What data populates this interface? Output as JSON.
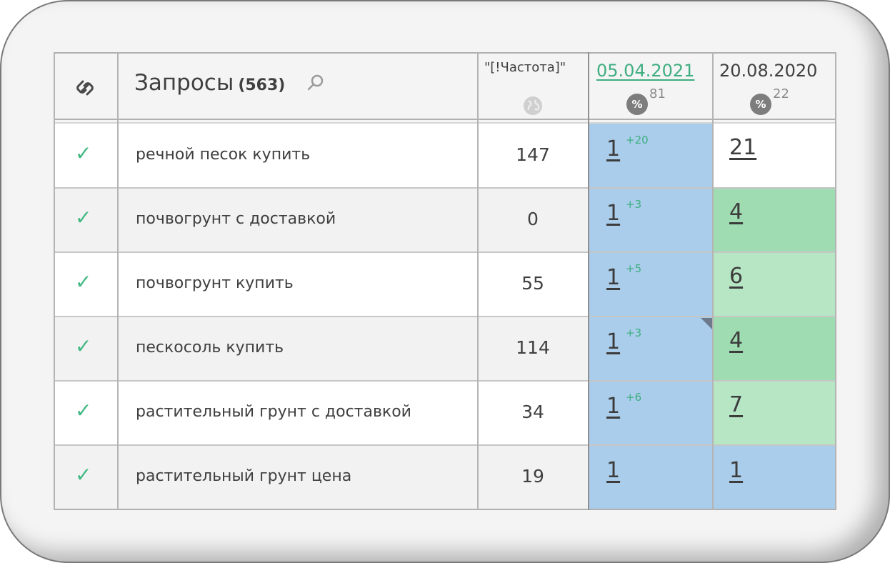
{
  "header": {
    "link_icon": "link-icon",
    "queries_label": "Запросы",
    "queries_count": "(563)",
    "search_icon": "search-icon",
    "frequency_label": "\"[!Частота]\"",
    "globe_icon": "globe-icon",
    "dates": [
      {
        "label": "05.04.2021",
        "badge": "%",
        "badge_value": "81"
      },
      {
        "label": "20.08.2020",
        "badge": "%",
        "badge_value": "22"
      }
    ]
  },
  "rows": [
    {
      "query": "речной песок купить",
      "frequency": "147",
      "pos1": "1",
      "delta1": "+20",
      "pos2": "21"
    },
    {
      "query": "почвогрунт с доставкой",
      "frequency": "0",
      "pos1": "1",
      "delta1": "+3",
      "pos2": "4"
    },
    {
      "query": "почвогрунт купить",
      "frequency": "55",
      "pos1": "1",
      "delta1": "+5",
      "pos2": "6"
    },
    {
      "query": "пескосоль купить",
      "frequency": "114",
      "pos1": "1",
      "delta1": "+3",
      "pos2": "4"
    },
    {
      "query": "растительный грунт с доставкой",
      "frequency": "34",
      "pos1": "1",
      "delta1": "+6",
      "pos2": "7"
    },
    {
      "query": "растительный грунт цена",
      "frequency": "19",
      "pos1": "1",
      "delta1": "",
      "pos2": "1"
    }
  ],
  "colors": {
    "accent_green": "#42b883",
    "date_link": "#3fae80",
    "top1_blue": "#a9cdea",
    "top5_green": "#9fdcb1",
    "top10_green": "#b6e6c4",
    "row_white": "#ffffff",
    "row_gray": "#f2f2f2"
  }
}
